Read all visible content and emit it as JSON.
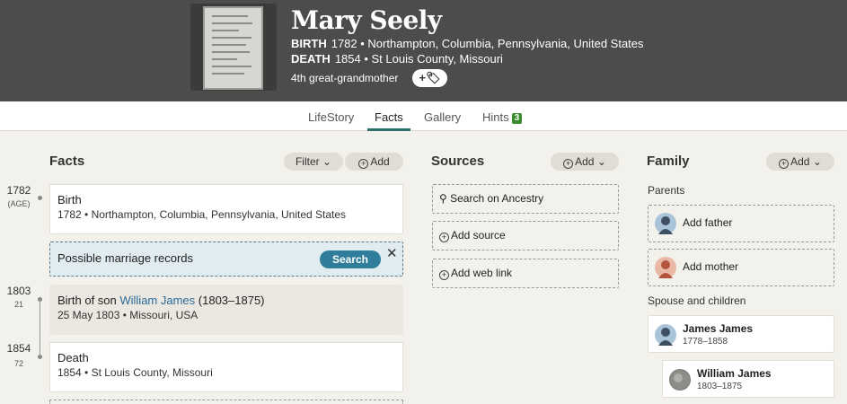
{
  "profile": {
    "name": "Mary Seely",
    "birth_label": "BIRTH",
    "birth_value": "1782 • Northampton, Columbia, Pennsylvania, United States",
    "death_label": "DEATH",
    "death_value": "1854 • St Louis County, Missouri",
    "relationship": "4th great-grandmother",
    "tag_button": "+🏷"
  },
  "tabs": {
    "lifestory": "LifeStory",
    "facts": "Facts",
    "gallery": "Gallery",
    "hints": "Hints",
    "hints_count": "3",
    "active": "Facts"
  },
  "facts_section": {
    "title": "Facts",
    "filter_label": "Filter",
    "add_label": "Add",
    "items": [
      {
        "year": "1782",
        "age": "(AGE)",
        "title": "Birth",
        "detail": "1782 • Northampton, Columbia, Pennsylvania, United States"
      },
      {
        "year": "1803",
        "age": "21",
        "title_prefix": "Birth of son ",
        "title_link": "William James",
        "title_suffix": " (1803–1875)",
        "detail": "25 May 1803 • Missouri, USA"
      },
      {
        "year": "1854",
        "age": "72",
        "title": "Death",
        "detail": "1854 • St Louis County, Missouri"
      }
    ],
    "hint": {
      "text": "Possible marriage records",
      "button": "Search",
      "close": "✕"
    }
  },
  "sources_section": {
    "title": "Sources",
    "add_label": "Add",
    "items": [
      "Search on Ancestry",
      "Add source",
      "Add web link"
    ]
  },
  "family_section": {
    "title": "Family",
    "add_label": "Add",
    "parents_label": "Parents",
    "add_father": "Add father",
    "add_mother": "Add mother",
    "spouse_label": "Spouse and children",
    "spouse": {
      "name": "James James",
      "years": "1778–1858"
    },
    "child": {
      "name": "William James",
      "years": "1803–1875"
    }
  },
  "colors": {
    "header_bg": "#4c4c4c",
    "accent": "#2a6f68",
    "search_button": "#2f7d9b",
    "hints_badge": "#3a8a2e"
  }
}
